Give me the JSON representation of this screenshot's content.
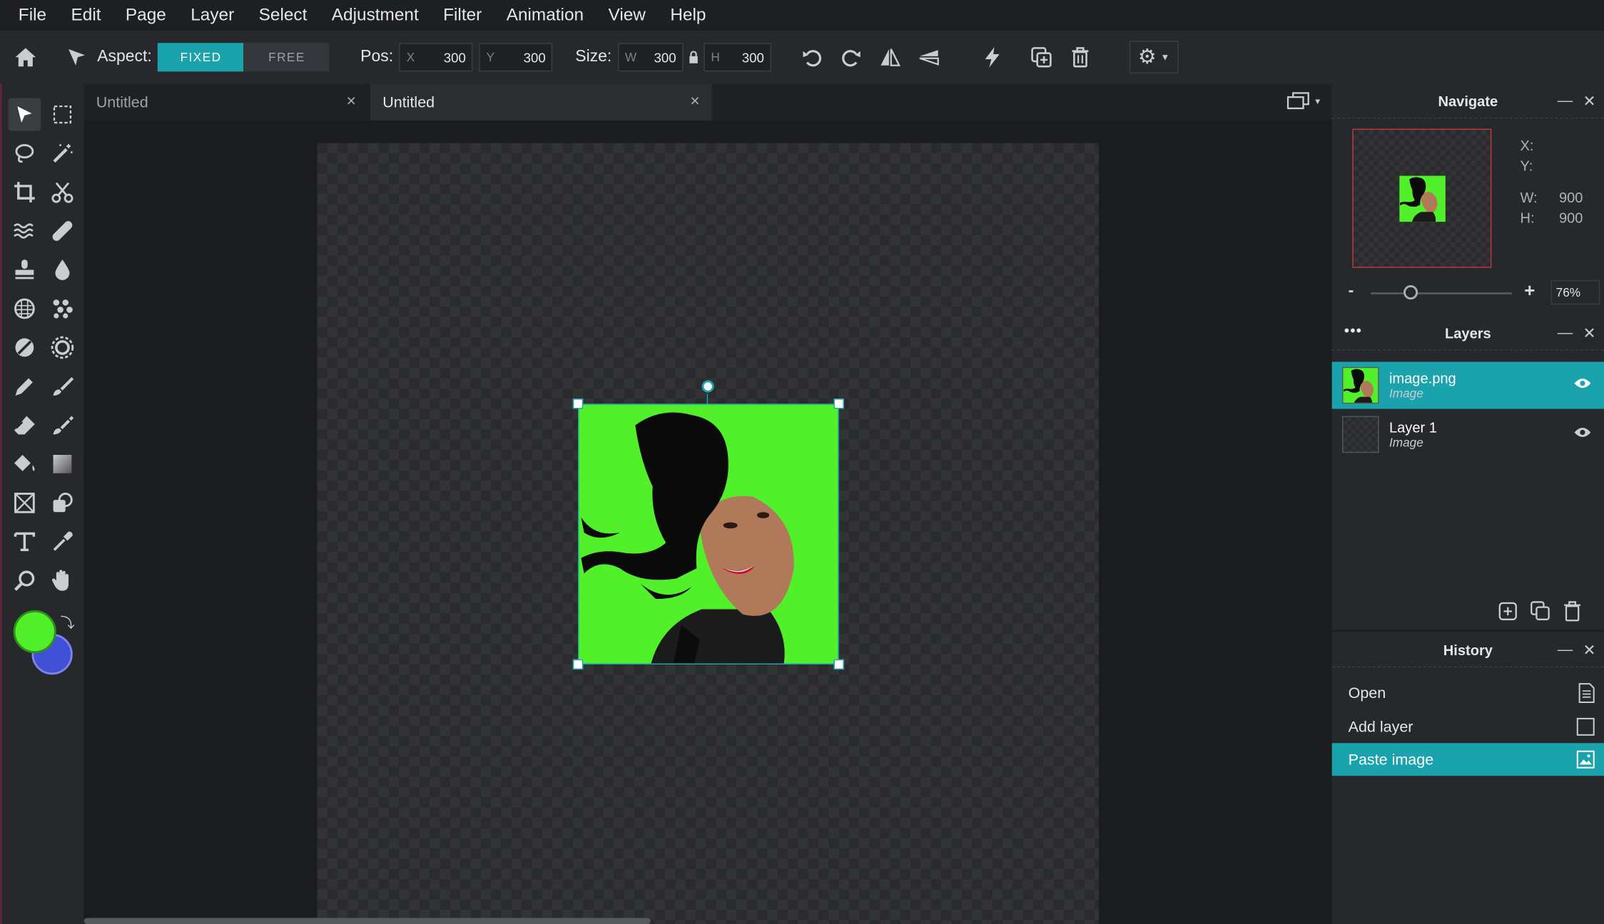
{
  "menu": [
    "File",
    "Edit",
    "Page",
    "Layer",
    "Select",
    "Adjustment",
    "Filter",
    "Animation",
    "View",
    "Help"
  ],
  "toolbar": {
    "aspect_label": "Aspect:",
    "aspect_fixed": "FIXED",
    "aspect_free": "FREE",
    "pos_label": "Pos:",
    "pos_x_key": "X",
    "pos_x": "300",
    "pos_y_key": "Y",
    "pos_y": "300",
    "size_label": "Size:",
    "size_w_key": "W",
    "size_w": "300",
    "size_h_key": "H",
    "size_h": "300"
  },
  "tabs": [
    {
      "title": "Untitled",
      "close": "×"
    },
    {
      "title": "Untitled",
      "close": "×"
    }
  ],
  "navigate": {
    "title": "Navigate",
    "x_label": "X:",
    "y_label": "Y:",
    "w_label": "W:",
    "w_value": "900",
    "h_label": "H:",
    "h_value": "900",
    "zoom_minus": "-",
    "zoom_plus": "+",
    "zoom_value": "76%"
  },
  "layers": {
    "title": "Layers",
    "items": [
      {
        "name": "image.png",
        "type": "Image"
      },
      {
        "name": "Layer 1",
        "type": "Image"
      }
    ]
  },
  "history": {
    "title": "History",
    "items": [
      "Open",
      "Add layer",
      "Paste image"
    ]
  },
  "colors": {
    "accent": "#1aa3ac",
    "foreground": "#52f02a",
    "background": "#3f4fd6"
  }
}
